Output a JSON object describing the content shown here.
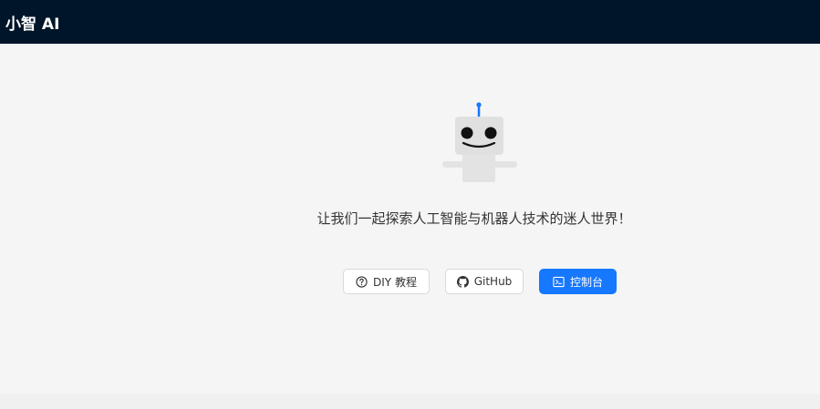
{
  "header": {
    "logo_text": "小智 AI",
    "background": "#001529"
  },
  "hero": {
    "illustration": "robot-icon",
    "tagline": "让我们一起探索人工智能与机器人技术的迷人世界！"
  },
  "actions": {
    "diy": {
      "label": "DIY 教程",
      "icon": "question-circle-icon"
    },
    "github": {
      "label": "GitHub",
      "icon": "github-icon"
    },
    "console": {
      "label": "控制台",
      "icon": "terminal-icon"
    }
  },
  "colors": {
    "primary": "#1677ff",
    "header_bg": "#001529",
    "page_bg": "#f5f5f5"
  }
}
